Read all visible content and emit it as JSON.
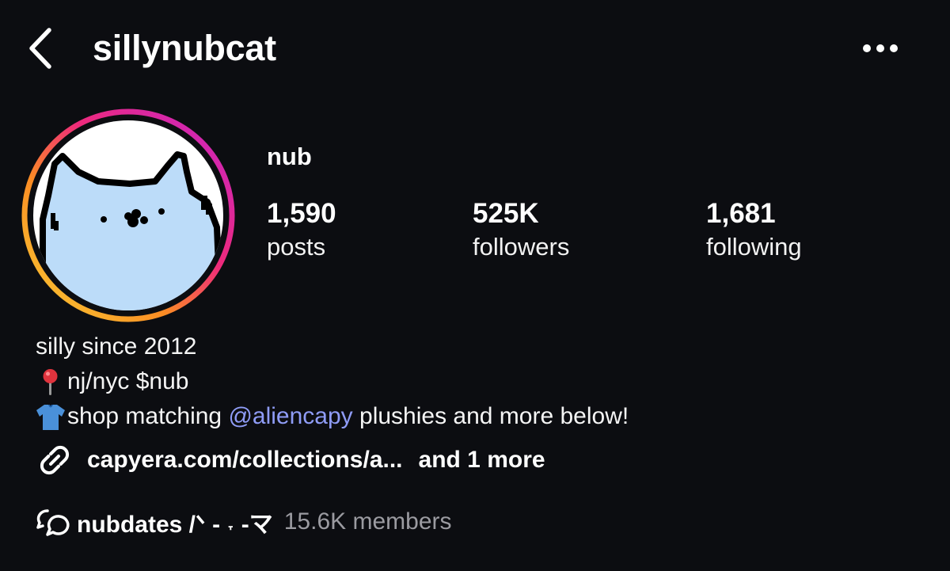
{
  "header": {
    "username": "sillynubcat",
    "back_icon": "chevron-left-icon",
    "more_icon": "more-horizontal-icon"
  },
  "profile": {
    "display_name": "nub",
    "avatar_icon": "cat-avatar",
    "story_ring_colors": [
      "#f9ce34",
      "#ee2a7b",
      "#c13584"
    ],
    "stats": [
      {
        "value": "1,590",
        "label": "posts"
      },
      {
        "value": "525K",
        "label": "followers"
      },
      {
        "value": "1,681",
        "label": "following"
      }
    ]
  },
  "bio": {
    "line1": "silly since 2012",
    "line2_icon": "pin-emoji",
    "line2": "nj/nyc $nub",
    "line3_icon": "shirt-emoji",
    "line3_pre": "shop matching ",
    "line3_mention": "@aliencapy",
    "line3_post": " plushies and more below!",
    "mention_color": "#8f9cf6"
  },
  "link": {
    "icon": "link-icon",
    "url": "capyera.com/collections/a...",
    "more": "and 1 more"
  },
  "community": {
    "icon": "chat-bubbles-icon",
    "name": "nubdates /ᐠ - ˕ -マ",
    "members": "15.6K members"
  }
}
